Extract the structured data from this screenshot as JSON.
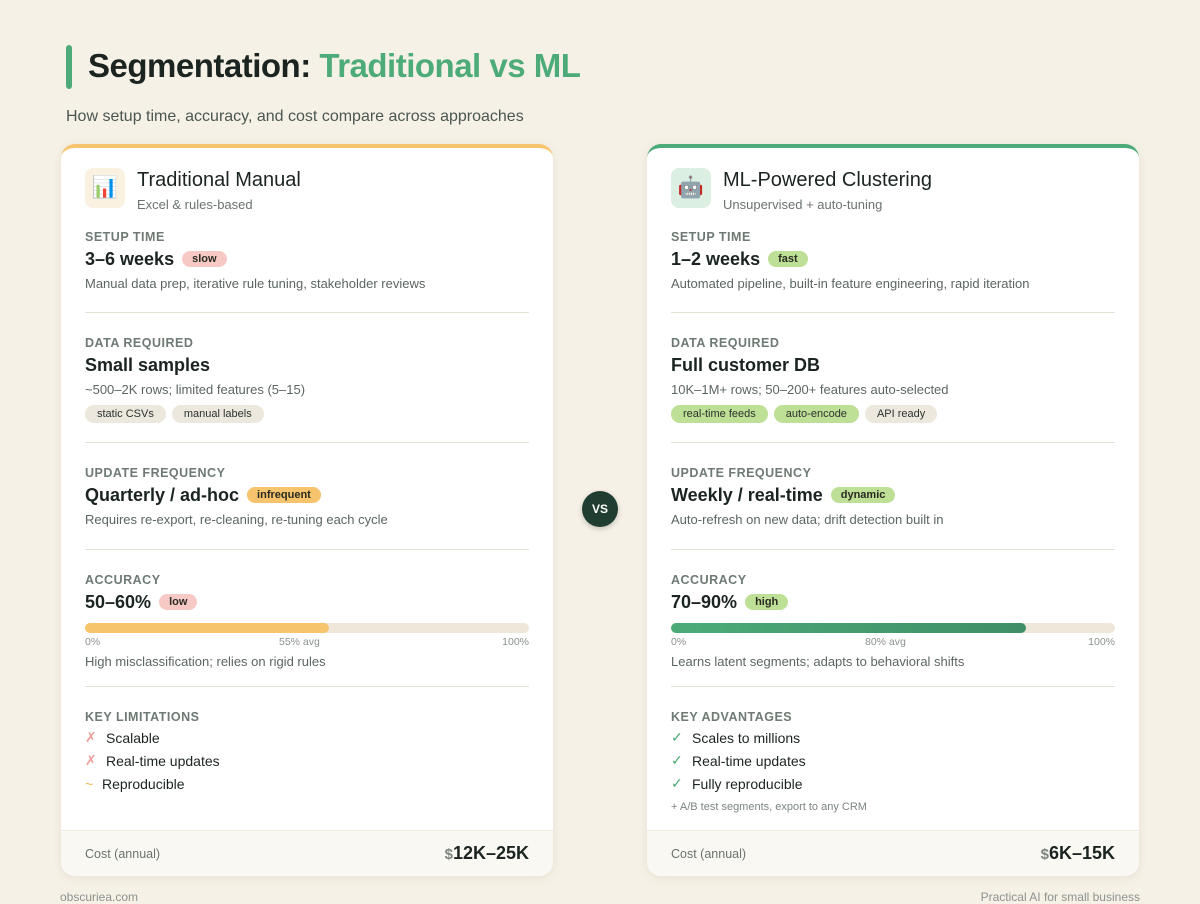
{
  "header": {
    "title_main": "Segmentation: ",
    "title_accent": "Traditional vs ML",
    "subtitle": "How setup time, accuracy, and cost compare across approaches",
    "accent_color": "#4cab78"
  },
  "vs_label": "VS",
  "left": {
    "icon": "bar-chart-icon",
    "name": "Traditional Manual",
    "sub": "Excel & rules-based",
    "setup": {
      "label": "SETUP TIME",
      "value": "3–6 weeks",
      "badge": "slow",
      "desc": "Manual data prep, iterative rule tuning, stakeholder reviews"
    },
    "data": {
      "label": "DATA REQUIRED",
      "value": "Small samples",
      "desc": "~500–2K rows; limited features (5–15)",
      "chips": [
        "static CSVs",
        "manual labels"
      ]
    },
    "update": {
      "label": "UPDATE FREQUENCY",
      "value": "Quarterly / ad-hoc",
      "badge": "infrequent",
      "desc": "Requires re-export, re-cleaning, re-tuning each cycle"
    },
    "accuracy": {
      "label": "ACCURACY",
      "value": "50–60%",
      "badge": "low",
      "fill_fraction": 0.55,
      "scale_min": "0%",
      "scale_mid": "55% avg",
      "scale_max": "100%",
      "desc": "High misclassification; relies on rigid rules"
    },
    "list": {
      "label": "KEY LIMITATIONS",
      "items": [
        {
          "mark": "✗",
          "text": "Scalable"
        },
        {
          "mark": "✗",
          "text": "Real-time updates"
        },
        {
          "mark": "~",
          "text": "Reproducible"
        }
      ]
    },
    "cost": {
      "label": "Cost (annual)",
      "currency": "$",
      "value": "12K–25K"
    },
    "color": "#f5c46c"
  },
  "right": {
    "icon": "robot-icon",
    "name": "ML-Powered Clustering",
    "sub": "Unsupervised + auto-tuning",
    "setup": {
      "label": "SETUP TIME",
      "value": "1–2 weeks",
      "badge": "fast",
      "desc": "Automated pipeline, built-in feature engineering, rapid iteration"
    },
    "data": {
      "label": "DATA REQUIRED",
      "value": "Full customer DB",
      "desc": "10K–1M+ rows; 50–200+ features auto-selected",
      "chips": [
        "real-time feeds",
        "auto-encode",
        "API ready"
      ]
    },
    "update": {
      "label": "UPDATE FREQUENCY",
      "value": "Weekly / real-time",
      "badge": "dynamic",
      "desc": "Auto-refresh on new data; drift detection built in"
    },
    "accuracy": {
      "label": "ACCURACY",
      "value": "70–90%",
      "badge": "high",
      "fill_fraction": 0.8,
      "scale_min": "0%",
      "scale_mid": "80% avg",
      "scale_max": "100%",
      "desc": "Learns latent segments; adapts to behavioral shifts"
    },
    "list": {
      "label": "KEY ADVANTAGES",
      "items": [
        {
          "mark": "✓",
          "text": "Scales to millions"
        },
        {
          "mark": "✓",
          "text": "Real-time updates"
        },
        {
          "mark": "✓",
          "text": "Fully reproducible"
        }
      ],
      "note": "+ A/B test segments, export to any CRM"
    },
    "cost": {
      "label": "Cost (annual)",
      "currency": "$",
      "value": "6K–15K"
    },
    "color": "#4cab78"
  },
  "footer": {
    "left": "obscuriea.com",
    "right": "Practical AI for small business"
  }
}
